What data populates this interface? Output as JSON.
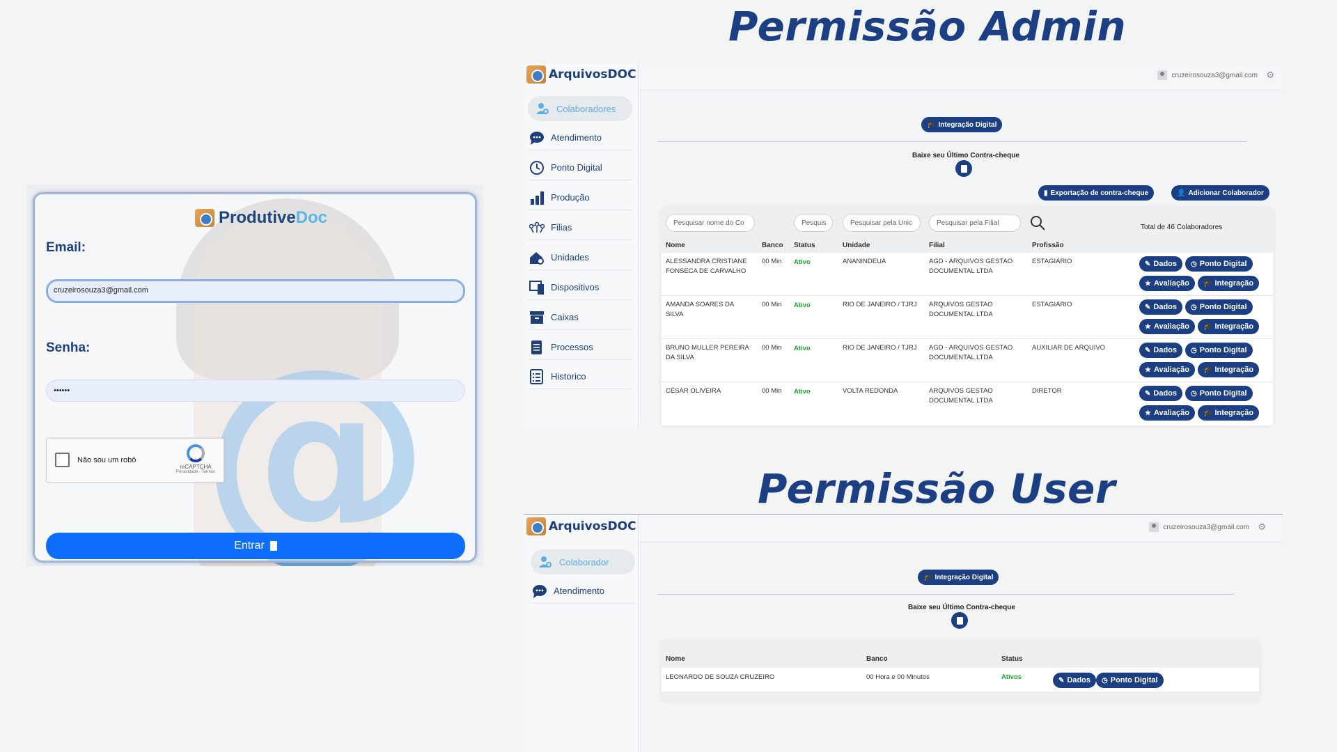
{
  "titles": {
    "admin": "Permissão Admin",
    "user": "Permissão User"
  },
  "login": {
    "brand_main": "Produtive",
    "brand_accent": "Doc",
    "email_label": "Email:",
    "email_value": "cruzeirosouza3@gmail.com",
    "password_label": "Senha:",
    "password_value": "••••••",
    "captcha_text": "Não sou um robô",
    "captcha_brand": "reCAPTCHA",
    "captcha_links": "Privacidade - Termos",
    "enter_label": "Entrar"
  },
  "colors": {
    "primary": "#1b3f82",
    "accent": "#56b7e8",
    "button_blue": "#0d6efd",
    "active_green": "#18a82e"
  },
  "app": {
    "brand": "ArquivosDOC",
    "user_email": "cruzeirosouza3@gmail.com",
    "integration_label": "Integração Digital",
    "payslip_label": "Baixe seu Último Contra-cheque"
  },
  "admin": {
    "nav": [
      {
        "label": "Colaboradores",
        "icon": "user-gear-icon"
      },
      {
        "label": "Atendimento",
        "icon": "chat-icon"
      },
      {
        "label": "Ponto Digital",
        "icon": "clock-icon"
      },
      {
        "label": "Produção",
        "icon": "bar-chart-icon"
      },
      {
        "label": "Filias",
        "icon": "network-icon"
      },
      {
        "label": "Unidades",
        "icon": "house-gear-icon"
      },
      {
        "label": "Dispositivos",
        "icon": "devices-icon"
      },
      {
        "label": "Caixas",
        "icon": "archive-icon"
      },
      {
        "label": "Processos",
        "icon": "document-icon"
      },
      {
        "label": "Historico",
        "icon": "list-icon"
      }
    ],
    "export_label": "Exportação de contra-cheque",
    "add_label": "Adicionar Colaborador",
    "search": {
      "name_placeholder": "Pesquisar nome do Co",
      "status_placeholder": "Pesquis",
      "unit_placeholder": "Pesquisar pela Unic",
      "branch_placeholder": "Pesquisar pela Filial"
    },
    "total_label": "Total de 46 Colaboradores",
    "columns": [
      "Nome",
      "Banco",
      "Status",
      "Unidade",
      "Filial",
      "Profissão"
    ],
    "rows": [
      {
        "nome": "ALESSANDRA CRISTIANE FONSECA DE CARVALHO",
        "banco": "00 Min",
        "status": "Ativo",
        "unidade": "ANANINDEUA",
        "filial": "AGD - ARQUIVOS GESTAO DOCUMENTAL LTDA",
        "profissao": "ESTAGIÁRIO"
      },
      {
        "nome": "AMANDA SOARES DA SILVA",
        "banco": "00 Min",
        "status": "Ativo",
        "unidade": "RIO DE JANEIRO / TJRJ",
        "filial": "ARQUIVOS GESTAO DOCUMENTAL LTDA",
        "profissao": "ESTAGIÁRIO"
      },
      {
        "nome": "BRUNO MULLER PEREIRA DA SILVA",
        "banco": "00 Min",
        "status": "Ativo",
        "unidade": "RIO DE JANEIRO / TJRJ",
        "filial": "AGD - ARQUIVOS GESTAO DOCUMENTAL LTDA",
        "profissao": "AUXILIAR DE ARQUIVO"
      },
      {
        "nome": "CÉSAR OLIVEIRA",
        "banco": "00 Min",
        "status": "Ativo",
        "unidade": "VOLTA REDONDA",
        "filial": "ARQUIVOS GESTAO DOCUMENTAL LTDA",
        "profissao": "DIRETOR"
      }
    ],
    "actions": {
      "dados": "Dados",
      "ponto": "Ponto Digital",
      "avaliacao": "Avaliação",
      "integracao": "Integração"
    }
  },
  "user": {
    "nav": [
      {
        "label": "Colaborador",
        "icon": "user-gear-icon"
      },
      {
        "label": "Atendimento",
        "icon": "chat-icon"
      }
    ],
    "columns": [
      "Nome",
      "Banco",
      "Status"
    ],
    "row": {
      "nome": "LEONARDO DE SOUZA CRUZEIRO",
      "banco": "00 Hora e 00 Minutos",
      "status": "Ativos"
    },
    "actions": {
      "dados": "Dados",
      "ponto": "Ponto Digital"
    }
  }
}
